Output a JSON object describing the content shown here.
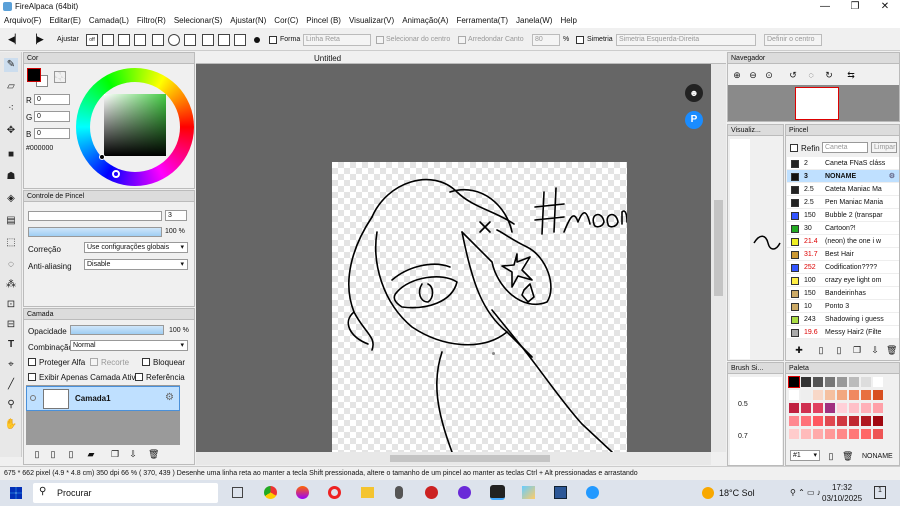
{
  "window": {
    "title": "FireAlpaca (64bit)"
  },
  "menu": [
    "Arquivo(F)",
    "Editar(E)",
    "Camada(L)",
    "Filtro(R)",
    "Selecionar(S)",
    "Ajustar(N)",
    "Cor(C)",
    "Pincel (B)",
    "Visualizar(V)",
    "Animação(A)",
    "Ferramenta(T)",
    "Janela(W)",
    "Help"
  ],
  "toolbar": {
    "ajustar": "Ajustar",
    "forma": "Forma",
    "shape_value": "Linha Reta",
    "select_center": "Selecionar do centro",
    "round_corner": "Arredondar Canto",
    "round_value": "80",
    "percent": "%",
    "symmetry": "Simetria",
    "symmetry_value": "Simetria Esquerda-Direita",
    "center": "Definir o centro"
  },
  "color": {
    "title": "Cor",
    "r_label": "R",
    "g_label": "G",
    "b_label": "B",
    "r": "0",
    "g": "0",
    "b": "0",
    "hex": "#000000",
    "current": "#000000"
  },
  "brush_control": {
    "title": "Controle de Pincel",
    "size": "3",
    "opacity": "100 %",
    "correction_label": "Correção",
    "correction_value": "Use configurações globais",
    "antialias_label": "Anti-aliasing",
    "antialias_value": "Disable"
  },
  "layer": {
    "title": "Camada",
    "opacity_label": "Opacidade",
    "opacity_value": "100 %",
    "blend_label": "Combinação",
    "blend_value": "Normal",
    "protect_alpha": "Proteger Alfa",
    "clip": "Recorte",
    "lock": "Bloquear",
    "show_active": "Exibir Apenas Camada Ativa",
    "reference": "Referência",
    "layer_name": "Camada1"
  },
  "document": {
    "tab": "Untitled",
    "text_on_canvas": "#Moon"
  },
  "navigator": {
    "title": "Navegador"
  },
  "brush_panel": {
    "preview_title": "Visualiz...",
    "title": "Pincel",
    "refine": "Refin",
    "refine_value": "Caneta",
    "clear": "Limpar",
    "brushes": [
      {
        "size": "2",
        "name": "Caneta FNaS clássica",
        "color": "#222222"
      },
      {
        "size": "3",
        "name": "NONAME",
        "color": "#111111",
        "active": true
      },
      {
        "size": "2.5",
        "name": "Cateta Maniac Ma",
        "color": "#222222"
      },
      {
        "size": "2.5",
        "name": "Pen Maniac Mania",
        "color": "#222222"
      },
      {
        "size": "150",
        "name": "Bubble 2 (transpar",
        "color": "#3355ff"
      },
      {
        "size": "30",
        "name": "Cartoon?!",
        "color": "#22aa22"
      },
      {
        "size": "21.4",
        "name": "(neon) the one i w",
        "color": "#eeee22",
        "red": true
      },
      {
        "size": "31.7",
        "name": "Best Hair",
        "color": "#cc9933",
        "red": true
      },
      {
        "size": "252",
        "name": "Codification????",
        "color": "#3355ff",
        "red": true
      },
      {
        "size": "100",
        "name": "crazy eye light om",
        "color": "#ffee44"
      },
      {
        "size": "150",
        "name": "Bandeirinhas",
        "color": "#ccaa66"
      },
      {
        "size": "10",
        "name": "Ponto 3",
        "color": "#ccaa66"
      },
      {
        "size": "243",
        "name": "Shadowing i guess",
        "color": "#aadd44"
      },
      {
        "size": "19.6",
        "name": "Messy Hair2 (Filte",
        "color": "#aaaaaa",
        "red": true
      }
    ]
  },
  "brush_size": {
    "title": "Brush Si...",
    "v1": "0.5",
    "v2": "0.7"
  },
  "palette": {
    "title": "Paleta",
    "name": "NONAME",
    "index": "#1"
  },
  "status": "675 * 662 pixel  (4.9 * 4.8 cm)  350 dpi  66 %  ( 370, 439 )  Desenhe uma linha reta ao manter a tecla Shift pressionada, altere o tamanho de um pincel ao manter as teclas Ctrl + Alt pressionadas e arrastando",
  "taskbar": {
    "search": "Procurar",
    "weather": "18°C  Sol",
    "time": "17:32",
    "date": "03/10/2025"
  }
}
